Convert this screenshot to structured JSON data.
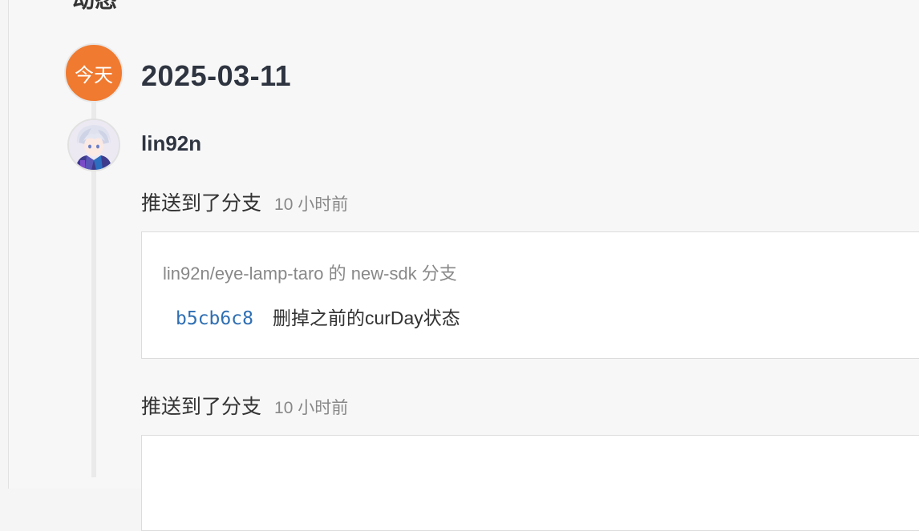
{
  "timeline": {
    "date_badge": "今天",
    "date": "2025-03-11"
  },
  "user": {
    "name": "lin92n"
  },
  "events": [
    {
      "action": "推送到了分支",
      "time": "10 小时前",
      "repo_branch": "lin92n/eye-lamp-taro 的 new-sdk 分支",
      "commit": {
        "hash": "b5cb6c8",
        "message": "删掉之前的curDay状态"
      }
    },
    {
      "action": "推送到了分支",
      "time": "10 小时前"
    }
  ],
  "icons": {
    "avatar": "anime-avatar"
  },
  "colors": {
    "badge": "#f07a2f",
    "hash": "#2f6fb3",
    "title": "#2e3440"
  }
}
